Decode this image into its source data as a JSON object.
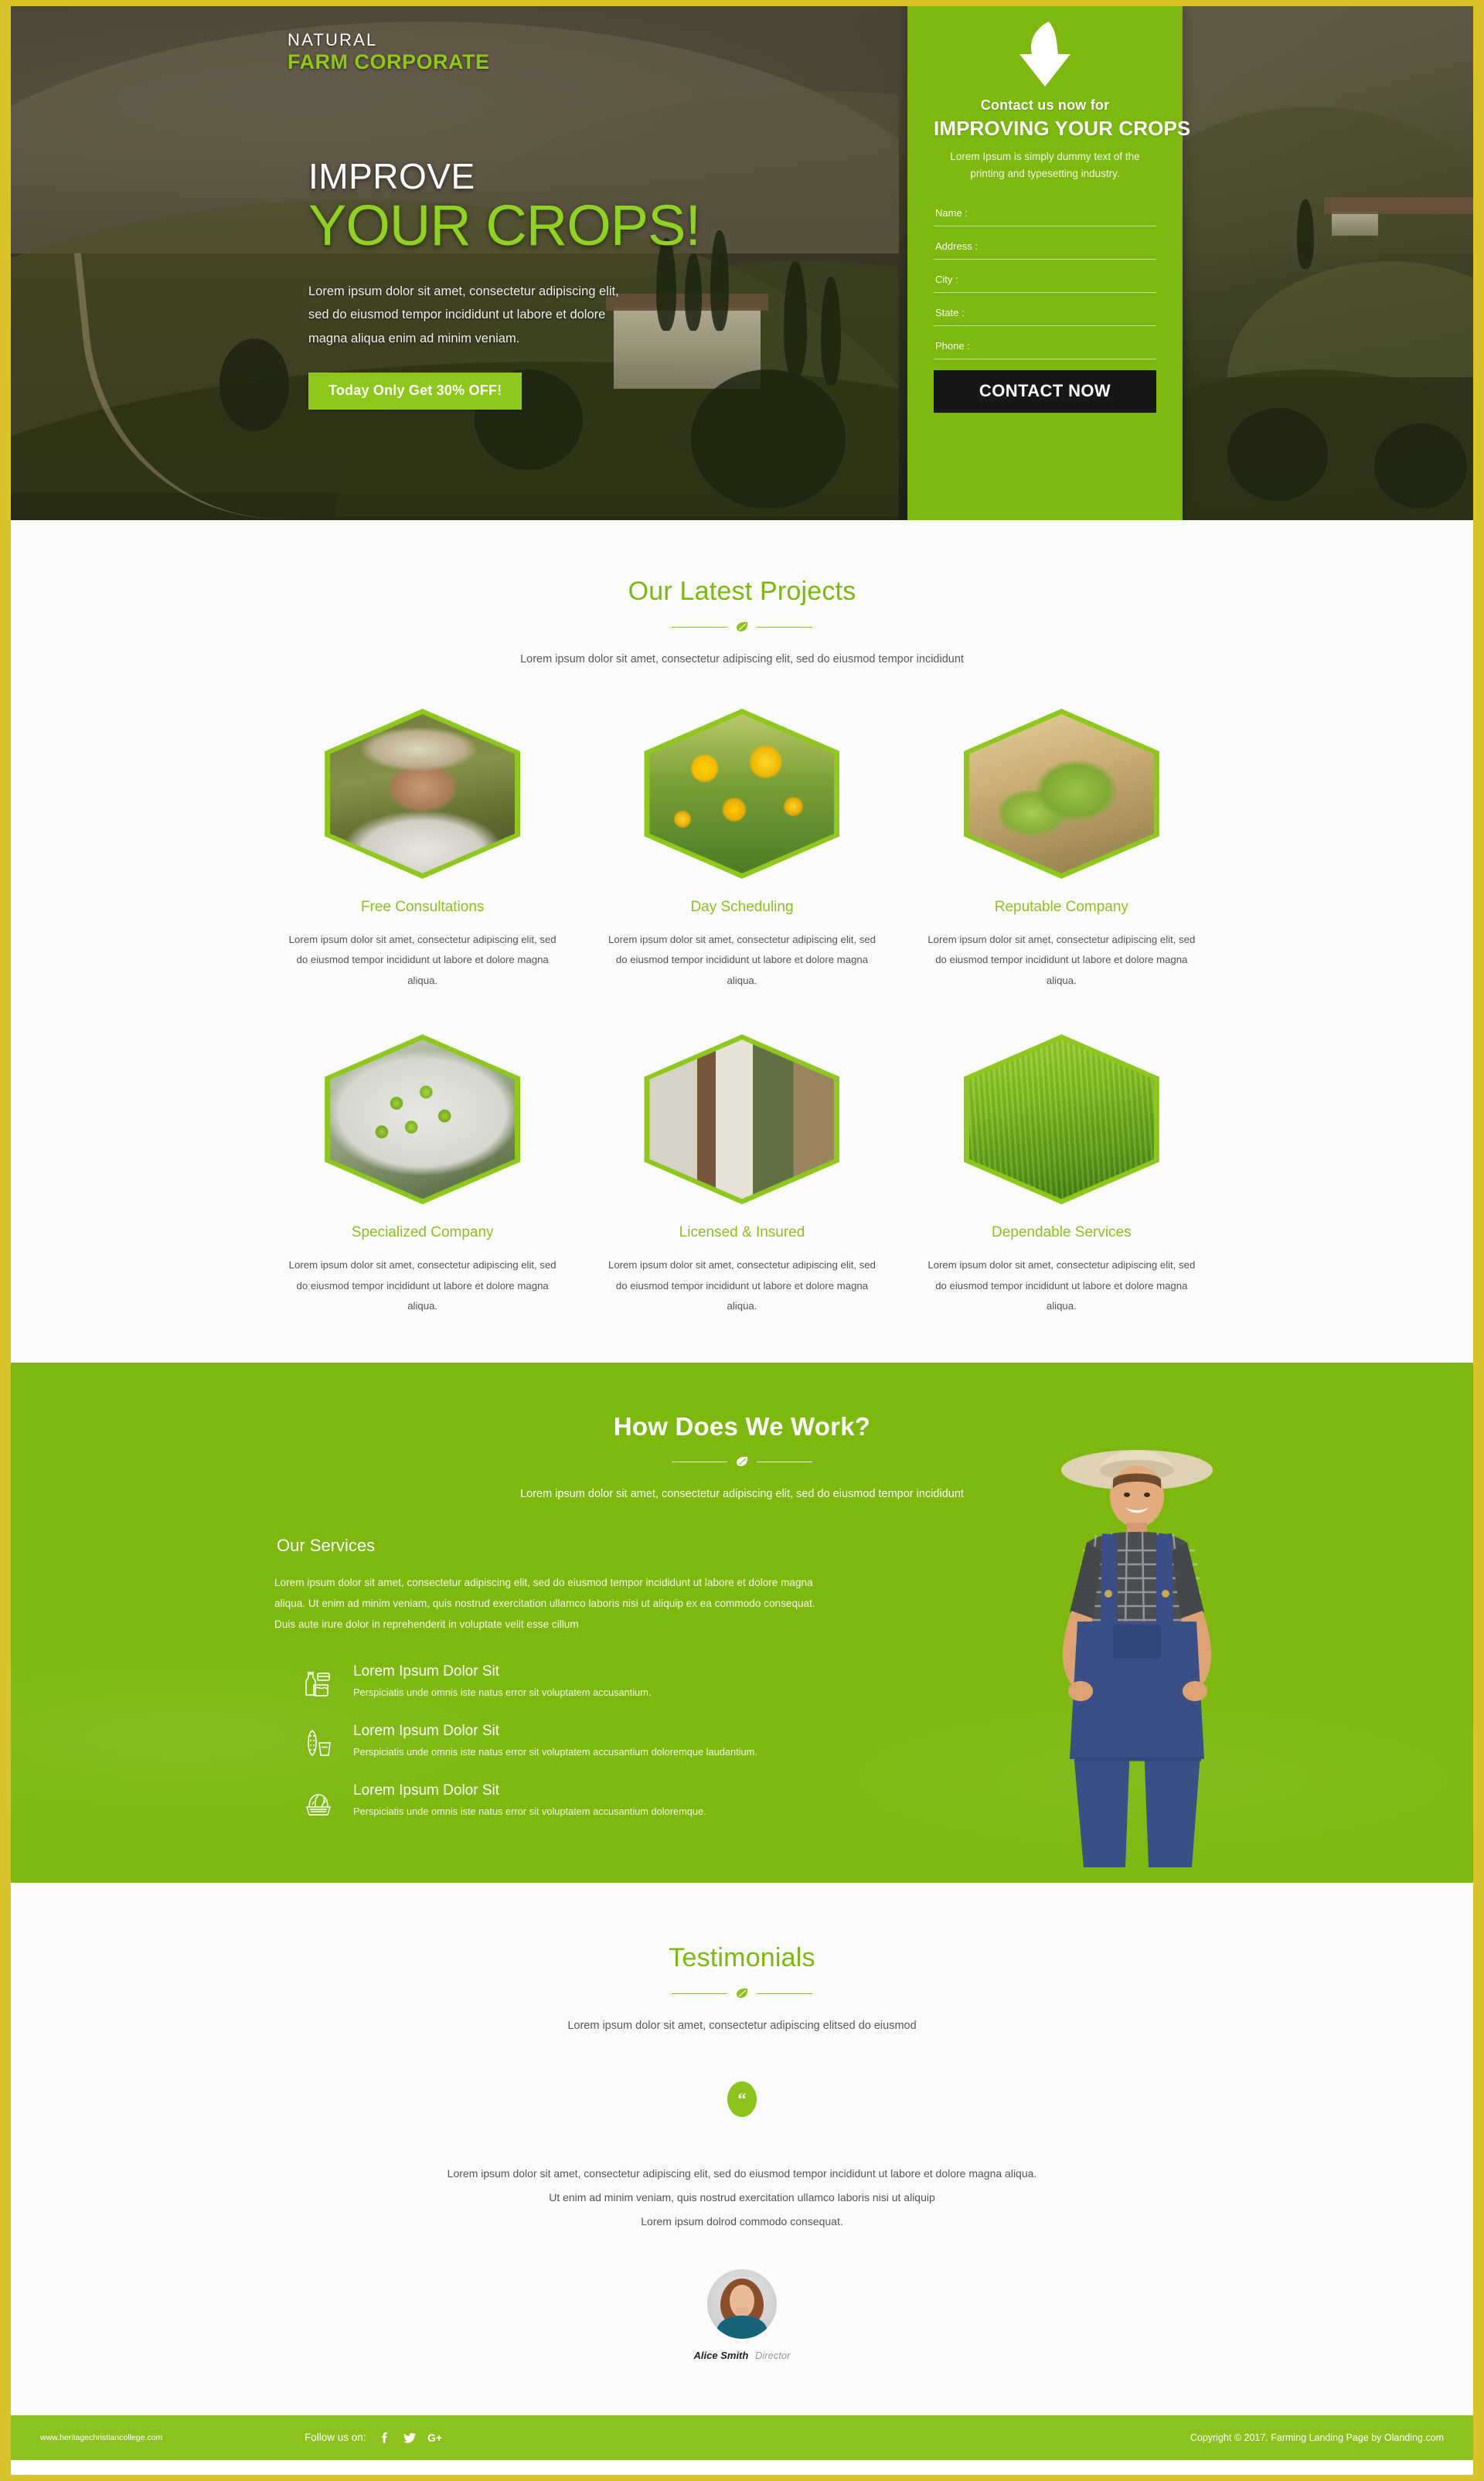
{
  "brand": {
    "line1": "NATURAL",
    "line2": "FARM CORPORATE",
    "accent": "#8fc817"
  },
  "hero": {
    "title_line1": "IMPROVE",
    "title_line2": "YOUR CROPS!",
    "paragraph": "Lorem ipsum dolor sit amet, consectetur adipiscing elit, sed do eiusmod tempor incididunt ut labore et dolore magna aliqua enim ad minim veniam.",
    "cta_label": "Today Only Get 30% OFF!",
    "cta_color": "#8dc81a"
  },
  "form": {
    "eyebrow": "Contact us now for",
    "heading": "IMPROVING YOUR  CROPS",
    "subtext": "Lorem Ipsum is simply dummy text of the printing and typesetting industry.",
    "panel_color": "#7cb80e",
    "arrow_icon": "arrow-down-icon",
    "fields": [
      {
        "name": "name",
        "placeholder": "Name :"
      },
      {
        "name": "address",
        "placeholder": "Address :"
      },
      {
        "name": "city",
        "placeholder": "City :"
      },
      {
        "name": "state",
        "placeholder": "State :"
      },
      {
        "name": "phone",
        "placeholder": "Phone :"
      }
    ],
    "submit_label": "CONTACT NOW",
    "submit_color": "#171717"
  },
  "projects": {
    "heading": "Our Latest Projects",
    "divider_icon": "leaf-icon",
    "subtitle": "Lorem ipsum dolor sit amet, consectetur adipiscing elit, sed do eiusmod tempor incididunt",
    "body_text": "Lorem ipsum dolor sit amet, consectetur adipiscing elit, sed do eiusmod tempor incididunt ut labore et dolore magna aliqua.",
    "cards": [
      {
        "title": "Free Consultations",
        "image": "farmer-with-corn-photo"
      },
      {
        "title": "Day Scheduling",
        "image": "sunflower-field-photo"
      },
      {
        "title": "Reputable Company",
        "image": "hops-harvest-photo"
      },
      {
        "title": "Specialized Company",
        "image": "green-peas-conveyor-photo"
      },
      {
        "title": "Licensed & Insured",
        "image": "door-to-door-visit-photo"
      },
      {
        "title": "Dependable Services",
        "image": "wheat-close-up-photo"
      }
    ]
  },
  "how": {
    "heading": "How Does We Work?",
    "divider_icon": "leaf-icon",
    "subtitle": "Lorem ipsum dolor sit amet, consectetur adipiscing elit, sed do eiusmod tempor incididunt",
    "services_heading": "Our Services",
    "lede": "Lorem ipsum dolor sit amet, consectetur adipiscing elit, sed do eiusmod tempor incididunt ut labore et dolore magna aliqua. Ut enim ad minim veniam, quis nostrud exercitation ullamco laboris nisi ut aliquip ex ea commodo consequat. Duis aute irure dolor in reprehenderit in voluptate velit esse cillum",
    "background_color": "#7cb80e",
    "items": [
      {
        "icon": "milk-bottle-and-jar-icon",
        "title": "Lorem Ipsum Dolor Sit",
        "desc": "Perspiciatis unde omnis iste natus error sit voluptatem accusantium."
      },
      {
        "icon": "corn-and-bucket-icon",
        "title": "Lorem Ipsum Dolor Sit",
        "desc": "Perspiciatis unde omnis iste natus error sit voluptatem accusantium doloremque laudantium."
      },
      {
        "icon": "vegetable-basket-icon",
        "title": "Lorem Ipsum Dolor Sit",
        "desc": "Perspiciatis unde omnis iste natus error sit voluptatem accusantium doloremque."
      }
    ],
    "farmer_image": "smiling-farmer-in-overalls-photo"
  },
  "testimonials": {
    "heading": "Testimonials",
    "divider_icon": "leaf-icon",
    "subtitle": "Lorem ipsum dolor sit amet, consectetur adipiscing elitsed do eiusmod",
    "quote_icon": "quote-mark-icon",
    "quote_line1": "Lorem ipsum dolor sit amet, consectetur adipiscing elit, sed do eiusmod tempor incididunt ut labore et dolore magna aliqua.",
    "quote_line2": "Ut enim ad minim veniam, quis nostrud exercitation ullamco laboris nisi ut aliquip",
    "quote_line3": "Lorem ipsum dolrod commodo consequat.",
    "author_name": "Alice Smith",
    "author_role": "Director",
    "author_avatar": "woman-portrait-avatar"
  },
  "footer": {
    "site_url": "www.heritagechristiancollege.com",
    "follow_label": "Follow us on:",
    "social": [
      {
        "icon": "facebook-icon",
        "glyph": "f"
      },
      {
        "icon": "twitter-icon",
        "glyph": "ᴠ"
      },
      {
        "icon": "google-plus-icon",
        "glyph": "G+"
      }
    ],
    "copyright": "Copyright © 2017. Farming Landing Page by  Olanding.com",
    "background_color": "#8cc21e"
  }
}
